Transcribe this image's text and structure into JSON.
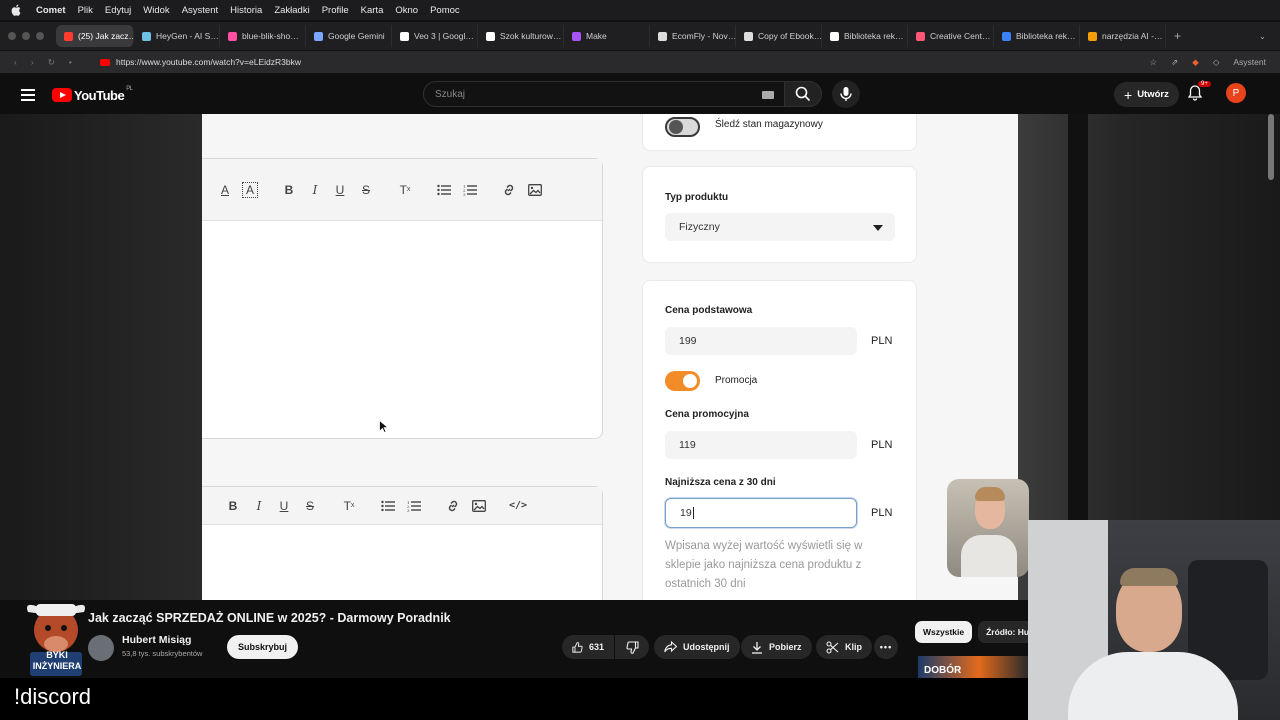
{
  "menubar": {
    "app": "Comet",
    "items": [
      "Plik",
      "Edytuj",
      "Widok",
      "Asystent",
      "Historia",
      "Zakładki",
      "Profile",
      "Karta",
      "Okno",
      "Pomoc"
    ]
  },
  "tabs": [
    {
      "label": "(25) Jak zacz…",
      "color": "#ff3b30"
    },
    {
      "label": "HeyGen - AI S…",
      "color": "#6ec1e4"
    },
    {
      "label": "blue-blik-sho…",
      "color": "#ff4fa0"
    },
    {
      "label": "Google Gemini",
      "color": "#7aa7ff"
    },
    {
      "label": "Veo 3 | Googl…",
      "color": "#ffffff"
    },
    {
      "label": "Szok kulturow…",
      "color": "#ffffff"
    },
    {
      "label": "Make",
      "color": "#a855f7"
    },
    {
      "label": "EcomFly - Nov…",
      "color": "#dddddd"
    },
    {
      "label": "Copy of Ebook…",
      "color": "#dddddd"
    },
    {
      "label": "Biblioteka rek…",
      "color": "#ffffff"
    },
    {
      "label": "Creative Cent…",
      "color": "#ff5577"
    },
    {
      "label": "Biblioteka rek…",
      "color": "#3b82f6"
    },
    {
      "label": "narzędzia AI -…",
      "color": "#f59e0b"
    }
  ],
  "address": {
    "url": "https://www.youtube.com/watch?v=eLEidzR3bkw",
    "assistant_label": "Asystent"
  },
  "youtube": {
    "logo_text": "YouTube",
    "region": "PL",
    "search_placeholder": "Szukaj",
    "create_label": "Utwórz",
    "notif_badge": "9+",
    "avatar_letter": "P"
  },
  "form": {
    "track_stock_label": "Śledź stan magazynowy",
    "product_type_label": "Typ produktu",
    "product_type_value": "Fizyczny",
    "base_price_label": "Cena podstawowa",
    "base_price_value": "199",
    "currency": "PLN",
    "promo_toggle_label": "Promocja",
    "promo_price_label": "Cena promocyjna",
    "promo_price_value": "119",
    "lowest_price_label": "Najniższa cena z 30 dni",
    "lowest_price_value": "19",
    "help_text": "Wpisana wyżej wartość wyświetli się w sklepie jako najniższa cena produktu z ostatnich 30 dni",
    "accent_color": "#f28c28"
  },
  "video": {
    "title": "Jak zacząć SPRZEDAŻ ONLINE w 2025? - Darmowy Poradnik",
    "channel": "Hubert Misiąg",
    "subscribers": "53,8 tys. subskrybentów",
    "subscribe_label": "Subskrybuj",
    "likes": "631",
    "share_label": "Udostępnij",
    "download_label": "Pobierz",
    "clip_label": "Klip",
    "channel_badge": "BYKI INŻYNIERA",
    "thumb_text": "DOBÓR"
  },
  "chips": [
    "Wszystkie",
    "Źródło: Hu"
  ],
  "overlay_text": "!discord"
}
